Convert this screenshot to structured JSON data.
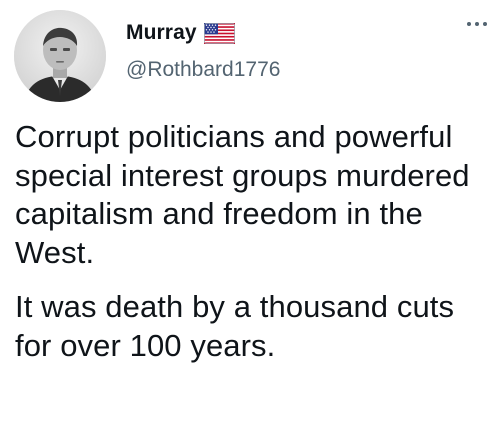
{
  "author": {
    "display_name": "Murray",
    "flag_icon": "us-flag-icon",
    "handle": "@Rothbard1776",
    "avatar_icon": "profile-photo"
  },
  "menu": {
    "more_icon": "more-horizontal-icon"
  },
  "tweet": {
    "paragraphs": [
      "Corrupt politicians and powerful special interest groups murdered capitalism and freedom in the West.",
      "It was death by a thousand cuts for over 100 years."
    ]
  },
  "colors": {
    "text_primary": "#0f1419",
    "text_secondary": "#536471",
    "background": "#ffffff"
  }
}
